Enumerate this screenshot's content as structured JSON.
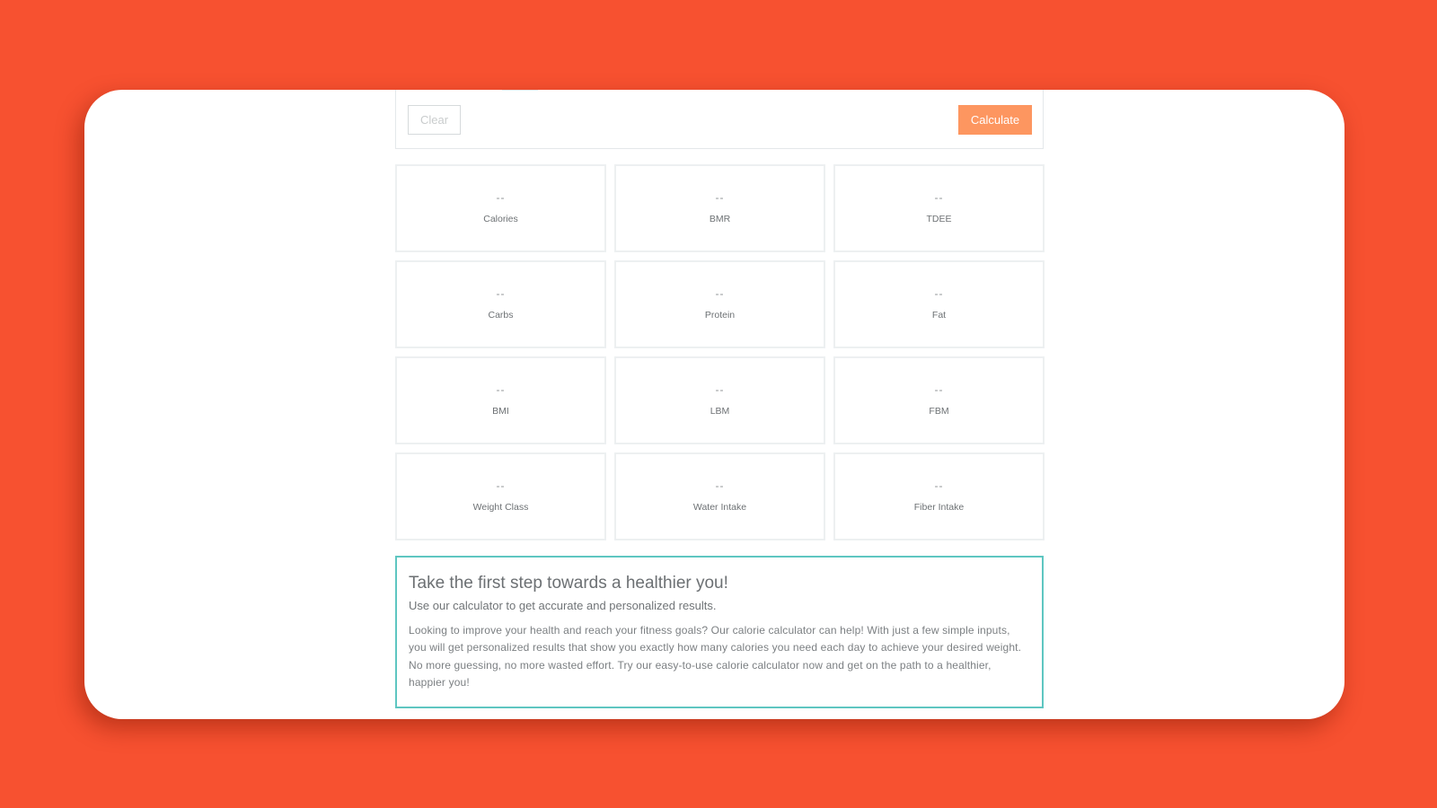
{
  "colors": {
    "background": "#f75130",
    "primary_button": "#fd9660",
    "info_border": "#5ec6c1"
  },
  "actions": {
    "clear_label": "Clear",
    "calculate_label": "Calculate"
  },
  "results": [
    {
      "label": "Calories",
      "value": "--"
    },
    {
      "label": "BMR",
      "value": "--"
    },
    {
      "label": "TDEE",
      "value": "--"
    },
    {
      "label": "Carbs",
      "value": "--"
    },
    {
      "label": "Protein",
      "value": "--"
    },
    {
      "label": "Fat",
      "value": "--"
    },
    {
      "label": "BMI",
      "value": "--"
    },
    {
      "label": "LBM",
      "value": "--"
    },
    {
      "label": "FBM",
      "value": "--"
    },
    {
      "label": "Weight Class",
      "value": "--"
    },
    {
      "label": "Water Intake",
      "value": "--"
    },
    {
      "label": "Fiber Intake",
      "value": "--"
    }
  ],
  "info": {
    "title": "Take the first step towards a healthier you!",
    "subtitle": "Use our calculator to get accurate and personalized results.",
    "body": "Looking to improve your health and reach your fitness goals? Our calorie calculator can help! With just a few simple inputs, you will get personalized results that show you exactly how many calories you need each day to achieve your desired weight. No more guessing, no more wasted effort. Try our easy-to-use calorie calculator now and get on the path to a healthier, happier you!"
  }
}
